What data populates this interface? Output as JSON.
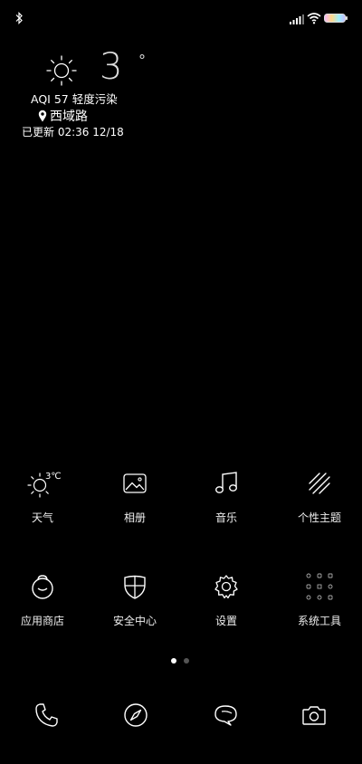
{
  "status_bar": {
    "bluetooth_icon": "bluetooth-icon",
    "signal_icon": "signal-icon",
    "wifi_icon": "wifi-icon",
    "battery_icon": "battery-icon"
  },
  "weather": {
    "icon": "sun-icon",
    "temperature": "3",
    "degree_symbol": "°",
    "aqi": "AQI 57 轻度污染",
    "location": "西域路",
    "updated": "已更新  02:36 12/18"
  },
  "apps": [
    {
      "label": "天气",
      "icon": "weather-icon",
      "badge": "3℃"
    },
    {
      "label": "相册",
      "icon": "gallery-icon"
    },
    {
      "label": "音乐",
      "icon": "music-icon"
    },
    {
      "label": "个性主题",
      "icon": "themes-icon"
    },
    {
      "label": "应用商店",
      "icon": "app-store-icon"
    },
    {
      "label": "安全中心",
      "icon": "security-icon"
    },
    {
      "label": "设置",
      "icon": "settings-icon"
    },
    {
      "label": "系统工具",
      "icon": "system-tools-folder-icon"
    }
  ],
  "page_indicator": {
    "pages": 2,
    "current": 1
  },
  "dock": [
    {
      "icon": "phone-icon"
    },
    {
      "icon": "browser-compass-icon"
    },
    {
      "icon": "messages-icon"
    },
    {
      "icon": "camera-icon"
    }
  ]
}
